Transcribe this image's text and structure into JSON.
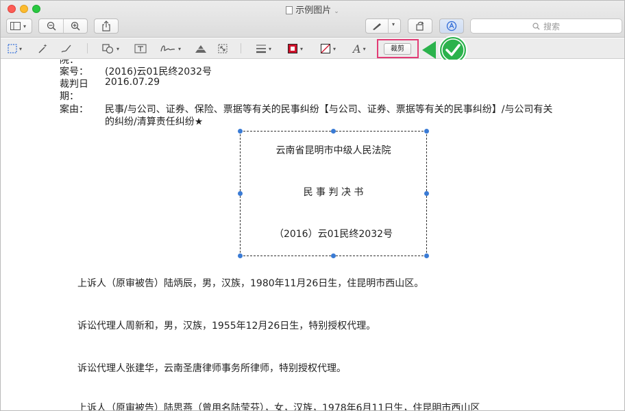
{
  "window": {
    "title": "示例图片",
    "search_placeholder": "搜索"
  },
  "markup": {
    "crop_label": "裁剪"
  },
  "document": {
    "top_cut_text": "院：",
    "case_no_label": "案号：",
    "case_no_value": "(2016)云01民终2032号",
    "date_label_1": "裁判日",
    "date_label_2": "期：",
    "date_value": "2016.07.29",
    "cause_label": "案由：",
    "cause_line1": "民事/与公司、证券、保险、票据等有关的民事纠纷【与公司、证券、票据等有关的民事纠纷】/与公司有关",
    "cause_line2": "的纠纷/清算责任纠纷★",
    "selection_court": "云南省昆明市中级人民法院",
    "selection_doc_type": "民 事 判 决 书",
    "selection_case_no": "（2016）云01民终2032号",
    "para1": "上诉人（原审被告）陆炳辰，男，汉族，1980年11月26日生，住昆明市西山区。",
    "para2": "诉讼代理人周新和，男，汉族，1955年12月26日生，特别授权代理。",
    "para3": "诉讼代理人张建华，云南圣唐律师事务所律师，特别授权代理。",
    "para4": "上诉人（原审被告）陆思燕（曾用名陆莹芬），女，汉族，1978年6月11日生，住昆明市西山区"
  },
  "colors": {
    "highlight": "#e23b75",
    "check_green": "#2bb24c",
    "selection_handle": "#3a7bd5"
  },
  "icons": {
    "sidebar": "sidebar-icon",
    "zoom_out": "zoom-out-icon",
    "zoom_in": "zoom-in-icon",
    "share": "share-icon",
    "pen": "pen-icon",
    "rotate": "rotate-icon",
    "markup": "markup-icon",
    "search": "search-icon",
    "check": "check-icon"
  }
}
